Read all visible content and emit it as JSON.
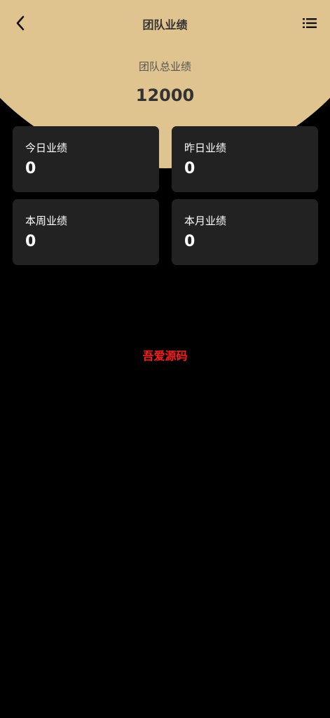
{
  "header": {
    "title": "团队业绩",
    "back_icon": "chevron-left-icon",
    "menu_icon": "list-menu-icon"
  },
  "summary": {
    "total_label": "团队总业绩",
    "total_value": "12000"
  },
  "stats": [
    {
      "label": "今日业绩",
      "value": "0"
    },
    {
      "label": "昨日业绩",
      "value": "0"
    },
    {
      "label": "本周业绩",
      "value": "0"
    },
    {
      "label": "本月业绩",
      "value": "0"
    }
  ],
  "watermark": {
    "text": "吾爱源码"
  },
  "colors": {
    "hero_background": "#e0c490",
    "page_background": "#000000",
    "card_background": "#222222",
    "watermark": "#ff1a1a"
  }
}
